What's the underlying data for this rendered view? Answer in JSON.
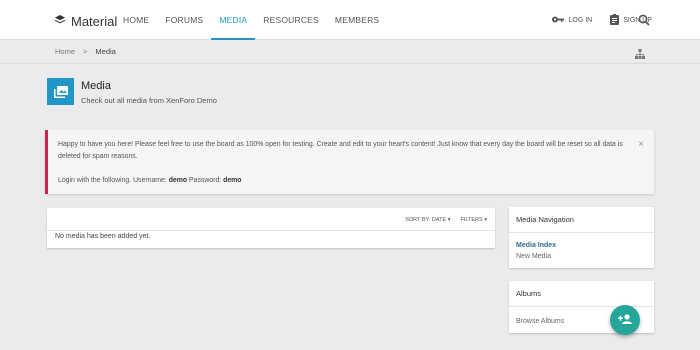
{
  "header": {
    "logo_text": "Material",
    "nav": [
      {
        "label": "HOME",
        "active": false
      },
      {
        "label": "FORUMS",
        "active": false
      },
      {
        "label": "MEDIA",
        "active": true
      },
      {
        "label": "RESOURCES",
        "active": false
      },
      {
        "label": "MEMBERS",
        "active": false
      }
    ],
    "login_label": "LOG IN",
    "signup_label": "SIGN UP",
    "icons": {
      "logo": "layers-icon",
      "login": "key-icon",
      "signup": "clipboard-icon",
      "search": "search-icon"
    }
  },
  "breadcrumb": {
    "home": "Home",
    "separator": ">",
    "current": "Media",
    "icon": "sitemap-icon"
  },
  "page": {
    "title": "Media",
    "description": "Check out all media from XenForo Demo",
    "icon": "image-gallery-icon"
  },
  "notice": {
    "text": "Happy to have you here! Please feel free to use the board as 100% open for testing. Create and edit to your heart's content! Just know that every day the board will be reset so all data is deleted for spam reasons.",
    "login_prefix": "Login with the following. Username:",
    "username": "demo",
    "password_prefix": "Password:",
    "password": "demo",
    "close": "×"
  },
  "media": {
    "sort_label": "SORT BY: DATE",
    "filters_label": "FILTERS",
    "empty_text": "No media has been added yet."
  },
  "sidebar": {
    "navigation": {
      "title": "Media Navigation",
      "links": [
        "Media Index",
        "New Media"
      ]
    },
    "albums": {
      "title": "Albums",
      "links": [
        "Browse Albums"
      ]
    }
  },
  "fab": {
    "icon": "add-user-icon"
  },
  "colors": {
    "accent": "#2196c9",
    "notice_border": "#c7254e",
    "fab": "#26a69a"
  }
}
